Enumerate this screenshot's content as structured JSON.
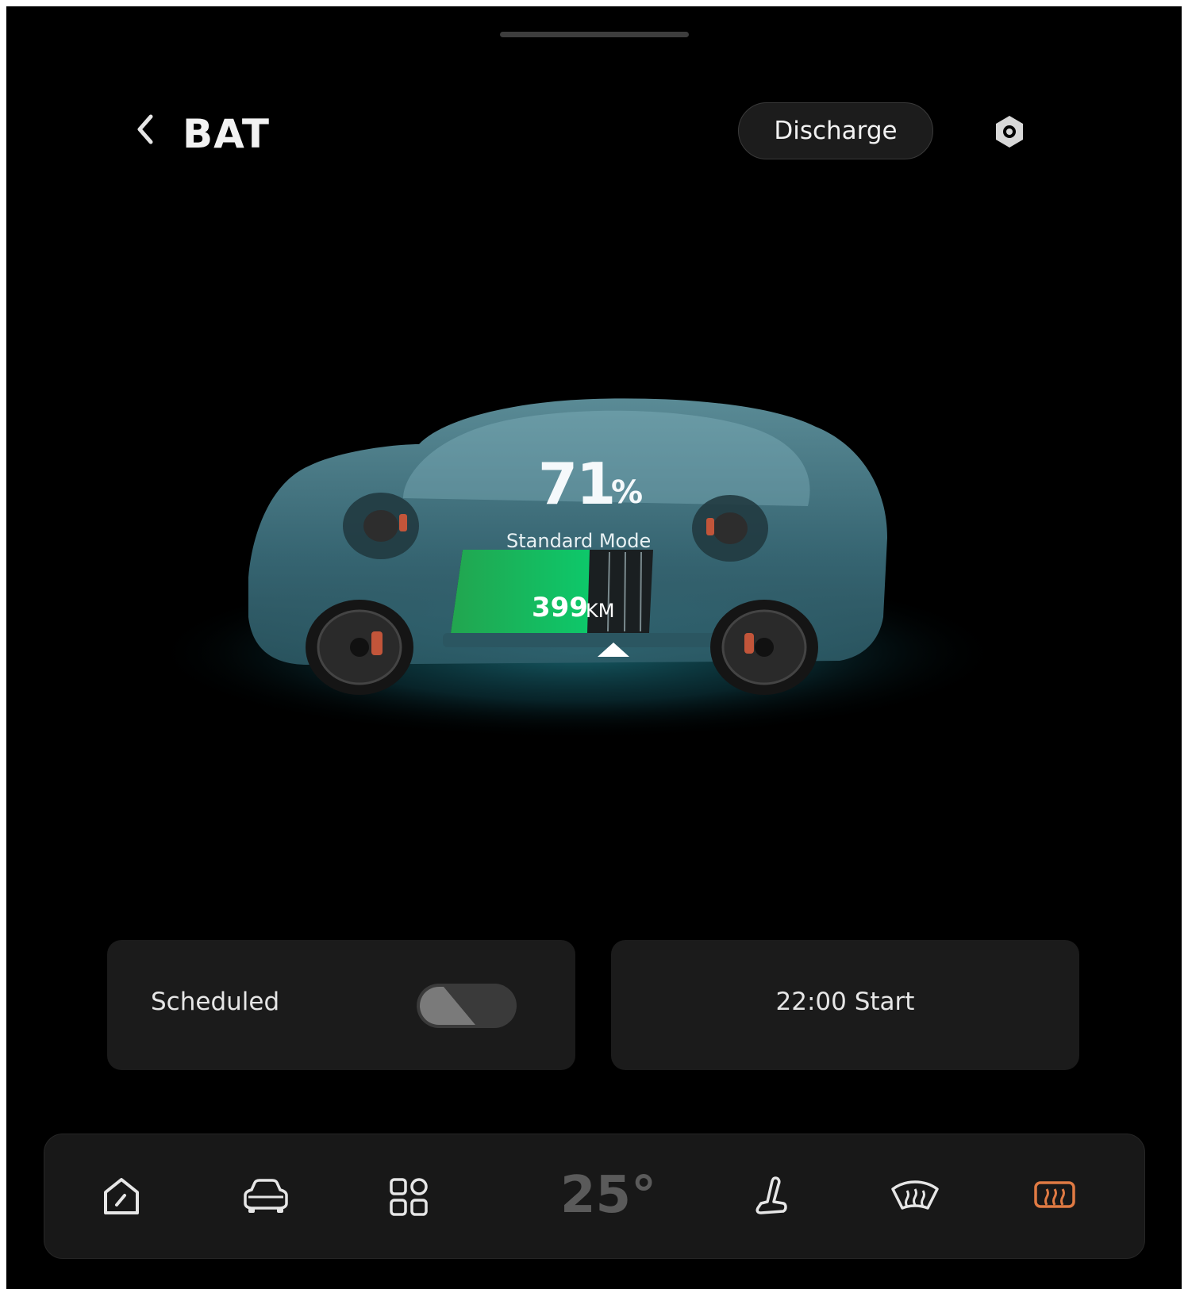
{
  "header": {
    "title": "BAT",
    "discharge_label": "Discharge"
  },
  "battery": {
    "soc_value": "71",
    "soc_unit": "%",
    "soc_fraction": 0.71,
    "mode": "Standard Mode",
    "range_value": "399",
    "range_unit": "KM"
  },
  "cards": {
    "scheduled_label": "Scheduled",
    "scheduled_on": false,
    "start_label": "22:00 Start"
  },
  "dock": {
    "items": [
      "dashboard-icon",
      "car-icon",
      "apps-icon",
      "seat-icon",
      "front-defrost-icon",
      "rear-defrost-icon"
    ],
    "temperature": "25°"
  },
  "colors": {
    "background": "#000000",
    "accent_green": "#1fbf5a",
    "active_orange": "#e07a43",
    "car_teal": "#4b8391"
  }
}
